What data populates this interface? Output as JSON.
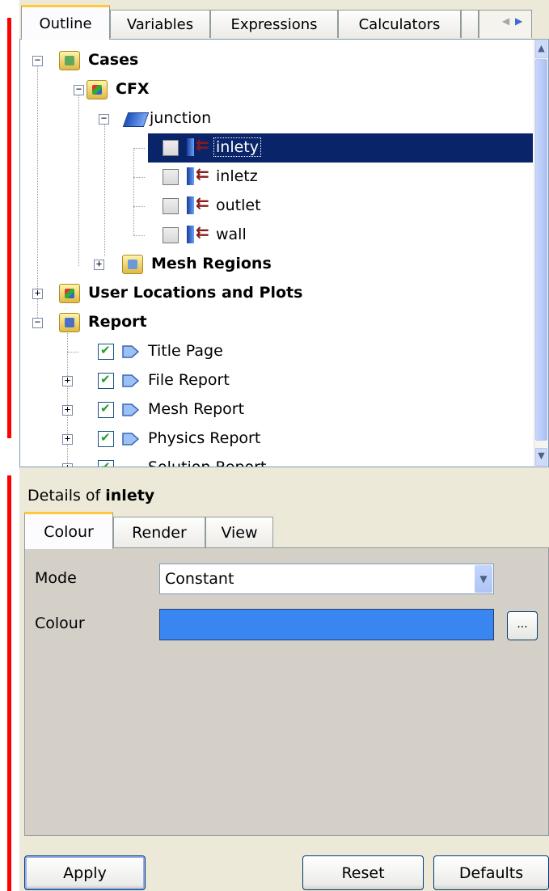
{
  "top_tabs": {
    "outline": "Outline",
    "variables": "Variables",
    "expressions": "Expressions",
    "calculators": "Calculators",
    "scroll_left": "◀",
    "scroll_right": "▶"
  },
  "tree": {
    "cases": "Cases",
    "cfx": "CFX",
    "junction": "junction",
    "inlety": "inlety",
    "inletz": "inletz",
    "outlet": "outlet",
    "wall": "wall",
    "mesh_regions": "Mesh Regions",
    "user_locations": "User Locations and Plots",
    "report": "Report",
    "title_page": "Title Page",
    "file_report": "File Report",
    "mesh_report": "Mesh Report",
    "physics_report": "Physics Report",
    "solution_report": "Solution Report",
    "expand_plus": "+",
    "collapse_minus": "−"
  },
  "details": {
    "title_prefix": "Details of ",
    "title_object": "inlety",
    "tabs": {
      "colour": "Colour",
      "render": "Render",
      "view": "View"
    },
    "mode_label": "Mode",
    "mode_value": "Constant",
    "colour_label": "Colour",
    "colour_value": "#3a86f0",
    "ellipsis": "...",
    "apply": "Apply",
    "reset": "Reset",
    "defaults": "Defaults"
  },
  "colors": {
    "selection": "#0a246a",
    "tab_highlight": "#ffc83c",
    "panel_bg": "#ece9d8"
  }
}
